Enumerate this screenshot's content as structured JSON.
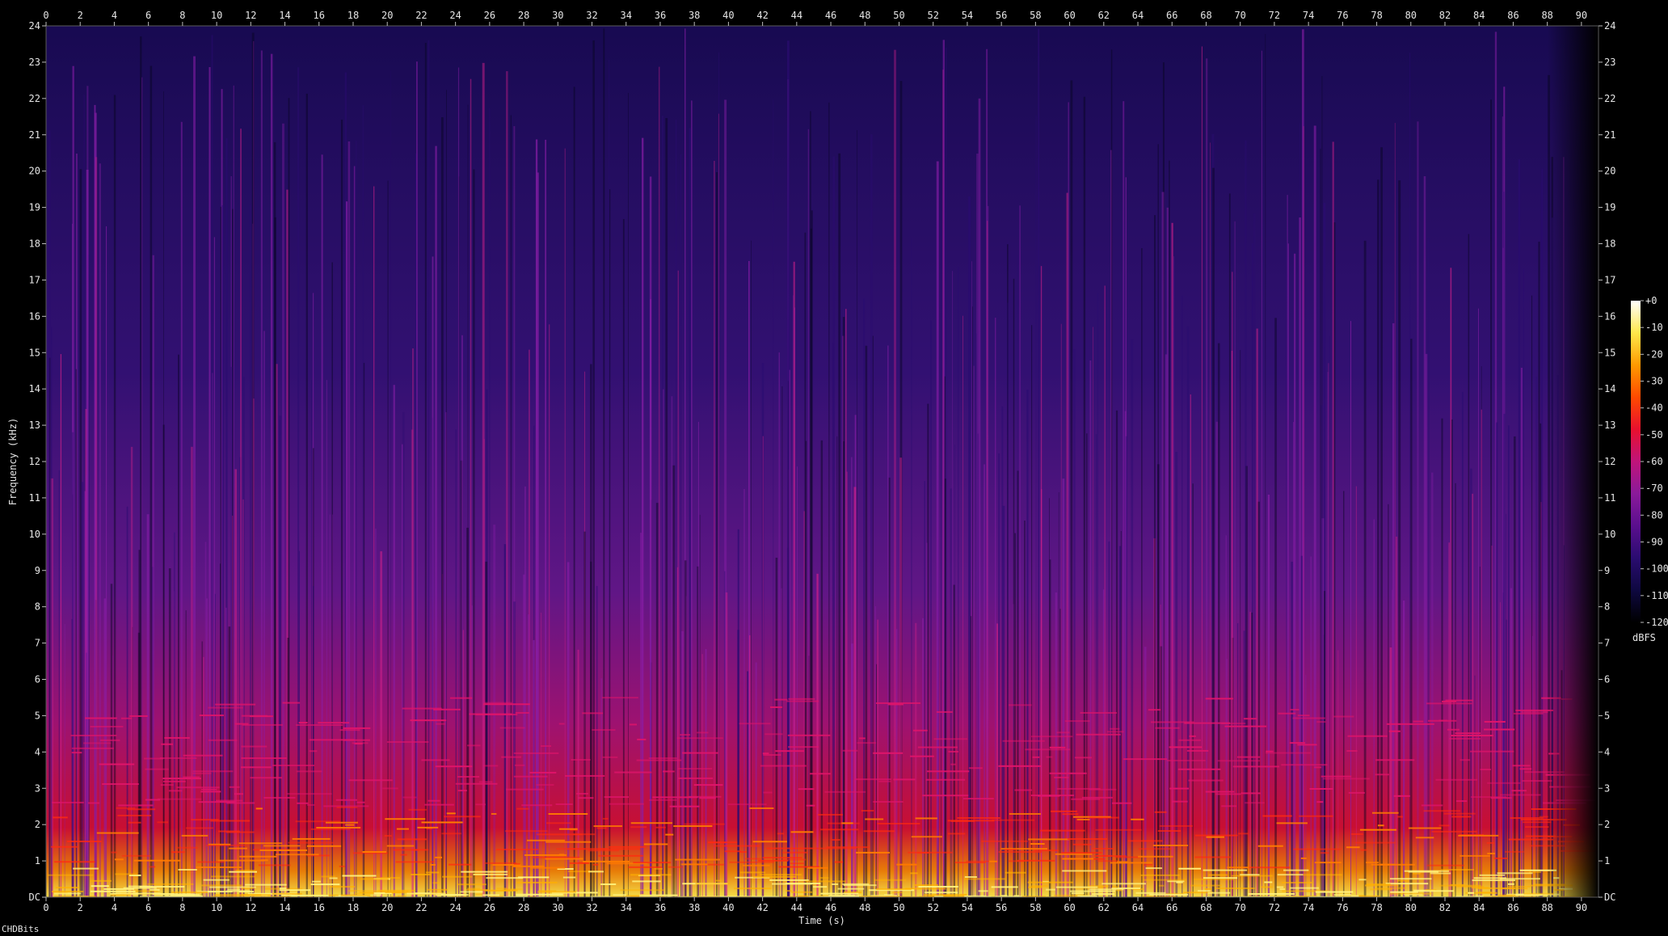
{
  "chart_data": {
    "type": "heatmap",
    "xlabel": "Time (s)",
    "ylabel": "Frequency (kHz)",
    "xlim": [
      0,
      91
    ],
    "ylim": [
      0,
      24
    ],
    "x_ticks": [
      0,
      2,
      4,
      6,
      8,
      10,
      12,
      14,
      16,
      18,
      20,
      22,
      24,
      26,
      28,
      30,
      32,
      34,
      36,
      38,
      40,
      42,
      44,
      46,
      48,
      50,
      52,
      54,
      56,
      58,
      60,
      62,
      64,
      66,
      68,
      70,
      72,
      74,
      76,
      78,
      80,
      82,
      84,
      86,
      88,
      90
    ],
    "y_ticks": [
      "DC",
      "1",
      "2",
      "3",
      "4",
      "5",
      "6",
      "7",
      "8",
      "9",
      "10",
      "11",
      "12",
      "13",
      "14",
      "15",
      "16",
      "17",
      "18",
      "19",
      "20",
      "21",
      "22",
      "23",
      "24"
    ],
    "colorbar": {
      "unit": "dBFS",
      "ticks": [
        "+0",
        "-10",
        "-20",
        "-30",
        "-40",
        "-50",
        "-60",
        "-70",
        "-80",
        "-90",
        "-100",
        "-110",
        "-120"
      ],
      "range": [
        -120,
        0
      ],
      "colors": [
        "#000000",
        "#1a0a5e",
        "#4a0f8a",
        "#8a1a9a",
        "#c0147a",
        "#e8102e",
        "#ff5a00",
        "#ffb000",
        "#ffe84a",
        "#ffffff"
      ]
    },
    "energy_decay_time": 89
  },
  "watermark": "CHDBits"
}
